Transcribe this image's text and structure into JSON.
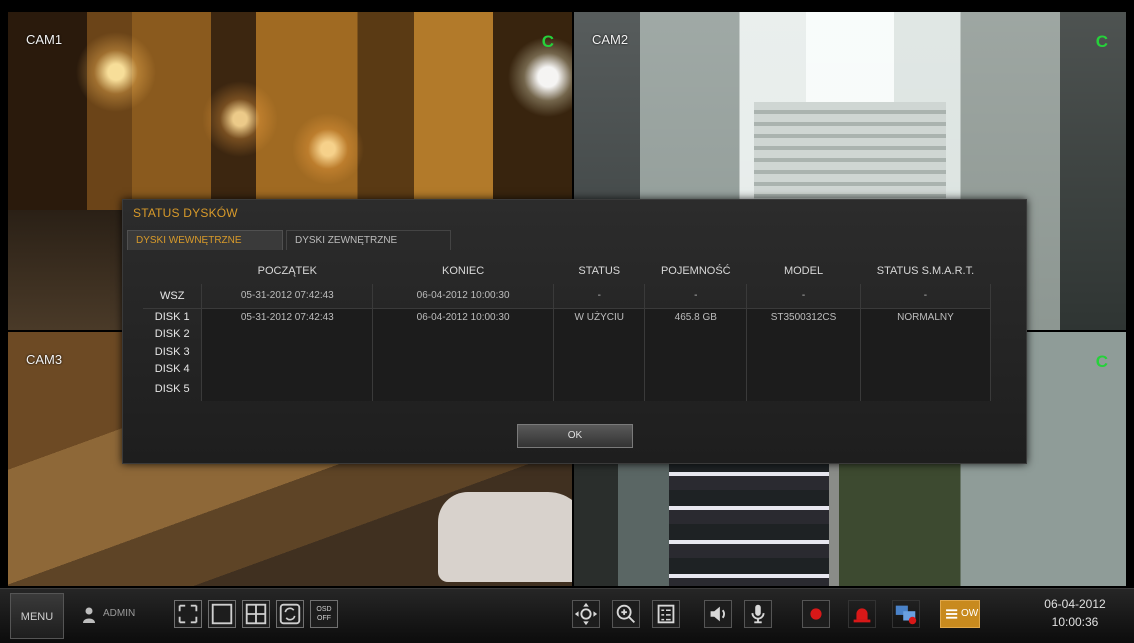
{
  "cameras": [
    {
      "label": "CAM1",
      "rec_badge": "C"
    },
    {
      "label": "CAM2",
      "rec_badge": "C"
    },
    {
      "label": "CAM3",
      "rec_badge": ""
    },
    {
      "label": "",
      "rec_badge": "C"
    }
  ],
  "dialog": {
    "title": "STATUS DYSKÓW",
    "tabs": [
      {
        "label": "DYSKI WEWNĘTRZNE",
        "active": true
      },
      {
        "label": "DYSKI ZEWNĘTRZNE",
        "active": false
      }
    ],
    "columns": [
      "",
      "POCZĄTEK",
      "KONIEC",
      "STATUS",
      "POJEMNOŚĆ",
      "MODEL",
      "STATUS S.M.A.R.T."
    ],
    "rows": [
      {
        "label": "WSZ",
        "start": "05-31-2012  07:42:43",
        "end": "06-04-2012  10:00:30",
        "status": "-",
        "capacity": "-",
        "model": "-",
        "smart": "-"
      },
      {
        "label": "DISK 1",
        "start": "05-31-2012  07:42:43",
        "end": "06-04-2012  10:00:30",
        "status": "W UŻYCIU",
        "capacity": "465.8 GB",
        "model": "ST3500312CS",
        "smart": "NORMALNY"
      },
      {
        "label": "DISK 2",
        "start": "",
        "end": "",
        "status": "",
        "capacity": "",
        "model": "",
        "smart": ""
      },
      {
        "label": "DISK 3",
        "start": "",
        "end": "",
        "status": "",
        "capacity": "",
        "model": "",
        "smart": ""
      },
      {
        "label": "DISK 4",
        "start": "",
        "end": "",
        "status": "",
        "capacity": "",
        "model": "",
        "smart": ""
      },
      {
        "label": "DISK 5",
        "start": "",
        "end": "",
        "status": "",
        "capacity": "",
        "model": "",
        "smart": ""
      }
    ],
    "ok_label": "OK"
  },
  "taskbar": {
    "menu_label": "MENU",
    "user": "ADMIN",
    "osd_label_top": "OSD",
    "osd_label_bottom": "OFF",
    "ow_label": "OW",
    "date": "06-04-2012",
    "time": "10:00:36",
    "icons": [
      "fullscreen-icon",
      "single-view-icon",
      "quad-view-icon",
      "sequence-icon",
      "osd-off-icon",
      "ptz-icon",
      "zoom-icon",
      "checklist-icon",
      "speaker-icon",
      "microphone-icon",
      "record-icon",
      "alarm-icon",
      "network-icon",
      "ow-icon"
    ]
  },
  "colors": {
    "accent": "#d89a2a",
    "rec": "#26d13a",
    "record_red": "#d81818"
  }
}
